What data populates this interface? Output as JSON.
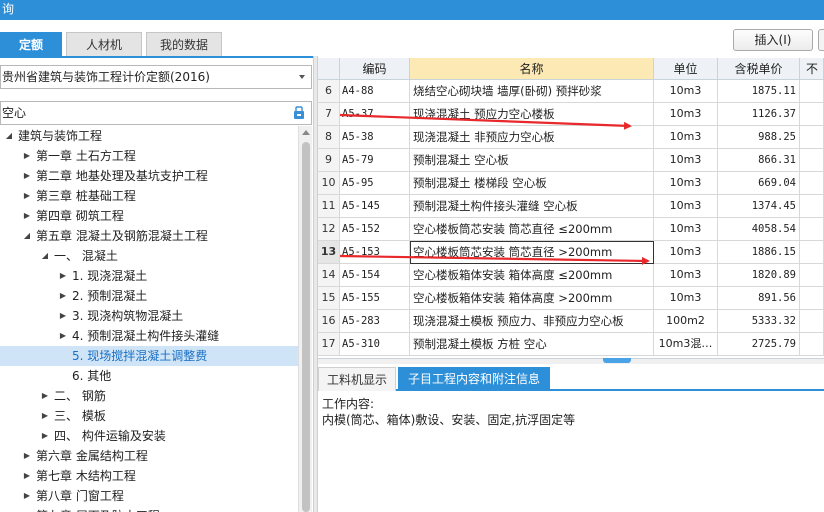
{
  "window": {
    "title": "询"
  },
  "tabs": [
    {
      "label": "定额",
      "active": true
    },
    {
      "label": "人材机",
      "active": false
    },
    {
      "label": "我的数据",
      "active": false
    }
  ],
  "toolbar": {
    "insert_label": "插入(I)"
  },
  "quota_select": {
    "value": "贵州省建筑与装饰工程计价定额(2016)"
  },
  "search": {
    "value": "空心",
    "icon": "search-filter-icon"
  },
  "tree": [
    {
      "label": "建筑与装饰工程",
      "expanded": true
    },
    {
      "label": "第一章 土石方工程",
      "expanded": false
    },
    {
      "label": "第二章 地基处理及基坑支护工程",
      "expanded": false
    },
    {
      "label": "第三章 桩基础工程",
      "expanded": false
    },
    {
      "label": "第四章 砌筑工程",
      "expanded": false
    },
    {
      "label": "第五章 混凝土及钢筋混凝土工程",
      "expanded": true
    },
    {
      "label": "一、 混凝土",
      "expanded": true
    },
    {
      "label": "1. 现浇混凝土",
      "expanded": false
    },
    {
      "label": "2. 预制混凝土",
      "expanded": false
    },
    {
      "label": "3. 现浇构筑物混凝土",
      "expanded": false
    },
    {
      "label": "4. 预制混凝土构件接头灌缝",
      "expanded": false
    },
    {
      "label": "5. 现场搅拌混凝土调整费",
      "selected": true
    },
    {
      "label": "6. 其他"
    },
    {
      "label": "二、 钢筋",
      "expanded": false
    },
    {
      "label": "三、 模板",
      "expanded": false
    },
    {
      "label": "四、 构件运输及安装",
      "expanded": false
    },
    {
      "label": "第六章 金属结构工程",
      "expanded": false
    },
    {
      "label": "第七章 木结构工程",
      "expanded": false
    },
    {
      "label": "第八章 门窗工程",
      "expanded": false
    },
    {
      "label": "第九章 屋面及防水工程",
      "expanded": false
    }
  ],
  "grid": {
    "columns": [
      "",
      "编码",
      "名称",
      "单位",
      "含税单价",
      "不"
    ],
    "rows": [
      {
        "num": "6",
        "code": "A4-88",
        "name": "烧结空心砌块墙 墙厚(卧砌) 预拌砂浆",
        "unit": "10m3",
        "price": "1875.11"
      },
      {
        "num": "7",
        "code": "A5-37",
        "name": "现浇混凝土 预应力空心楼板",
        "unit": "10m3",
        "price": "1126.37"
      },
      {
        "num": "8",
        "code": "A5-38",
        "name": "现浇混凝土 非预应力空心板",
        "unit": "10m3",
        "price": "988.25"
      },
      {
        "num": "9",
        "code": "A5-79",
        "name": "预制混凝土 空心板",
        "unit": "10m3",
        "price": "866.31"
      },
      {
        "num": "10",
        "code": "A5-95",
        "name": "预制混凝土 楼梯段 空心板",
        "unit": "10m3",
        "price": "669.04"
      },
      {
        "num": "11",
        "code": "A5-145",
        "name": "预制混凝土构件接头灌缝 空心板",
        "unit": "10m3",
        "price": "1374.45"
      },
      {
        "num": "12",
        "code": "A5-152",
        "name": "空心楼板筒芯安装 筒芯直径 ≤200mm",
        "unit": "10m3",
        "price": "4058.54"
      },
      {
        "num": "13",
        "code": "A5-153",
        "name": "空心楼板筒芯安装 筒芯直径 >200mm",
        "unit": "10m3",
        "price": "1886.15",
        "current": true
      },
      {
        "num": "14",
        "code": "A5-154",
        "name": "空心楼板箱体安装 箱体高度 ≤200mm",
        "unit": "10m3",
        "price": "1820.89"
      },
      {
        "num": "15",
        "code": "A5-155",
        "name": "空心楼板箱体安装 箱体高度 >200mm",
        "unit": "10m3",
        "price": "891.56"
      },
      {
        "num": "16",
        "code": "A5-283",
        "name": "现浇混凝土模板 预应力、非预应力空心板",
        "unit": "100m2",
        "price": "5333.32"
      },
      {
        "num": "17",
        "code": "A5-310",
        "name": "预制混凝土模板 方桩 空心",
        "unit": "10m3混…",
        "price": "2725.79"
      }
    ]
  },
  "bottom_tabs": [
    {
      "label": "工料机显示",
      "active": false
    },
    {
      "label": "子目工程内容和附注信息",
      "active": true
    }
  ],
  "details": {
    "heading": "工作内容:",
    "text": "内模(筒芯、箱体)敷设、安装、固定,抗浮固定等"
  },
  "colors": {
    "accent": "#2c8fd8",
    "arrow": "#e8282a",
    "header_highlight": "#fde9b4"
  }
}
